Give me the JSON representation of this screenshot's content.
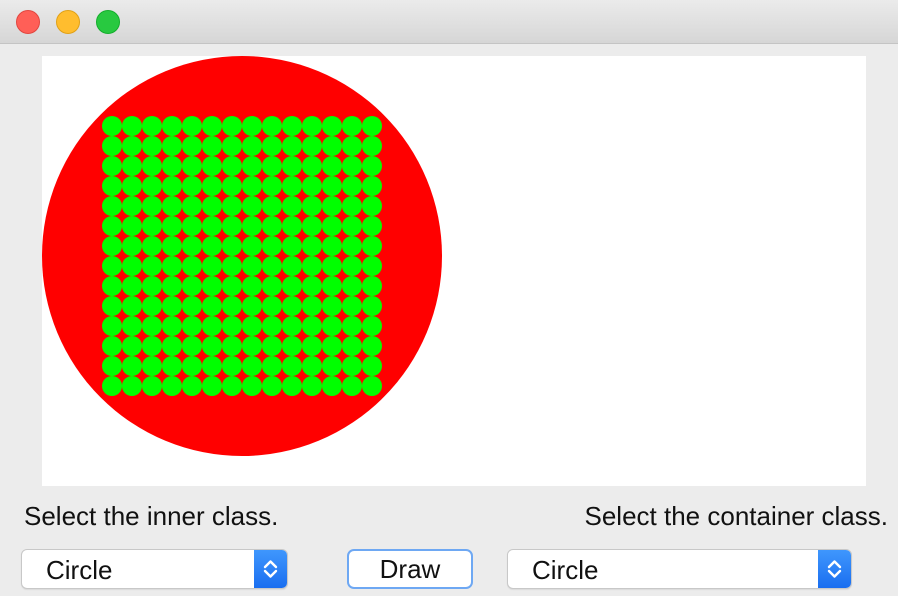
{
  "window": {
    "controls": [
      "close",
      "minimize",
      "zoom"
    ]
  },
  "canvas": {
    "container_shape": "circle",
    "container_color": "#ff0000",
    "inner_shape": "circle",
    "inner_color": "#00ff00",
    "grid_rows": 14,
    "grid_cols": 14
  },
  "controls": {
    "inner_label": "Select the inner class.",
    "container_label": "Select the container class.",
    "inner_select_value": "Circle",
    "container_select_value": "Circle",
    "draw_button_label": "Draw"
  },
  "colors": {
    "accent": "#1a6ef0",
    "button_focus": "#6ea8f3"
  }
}
